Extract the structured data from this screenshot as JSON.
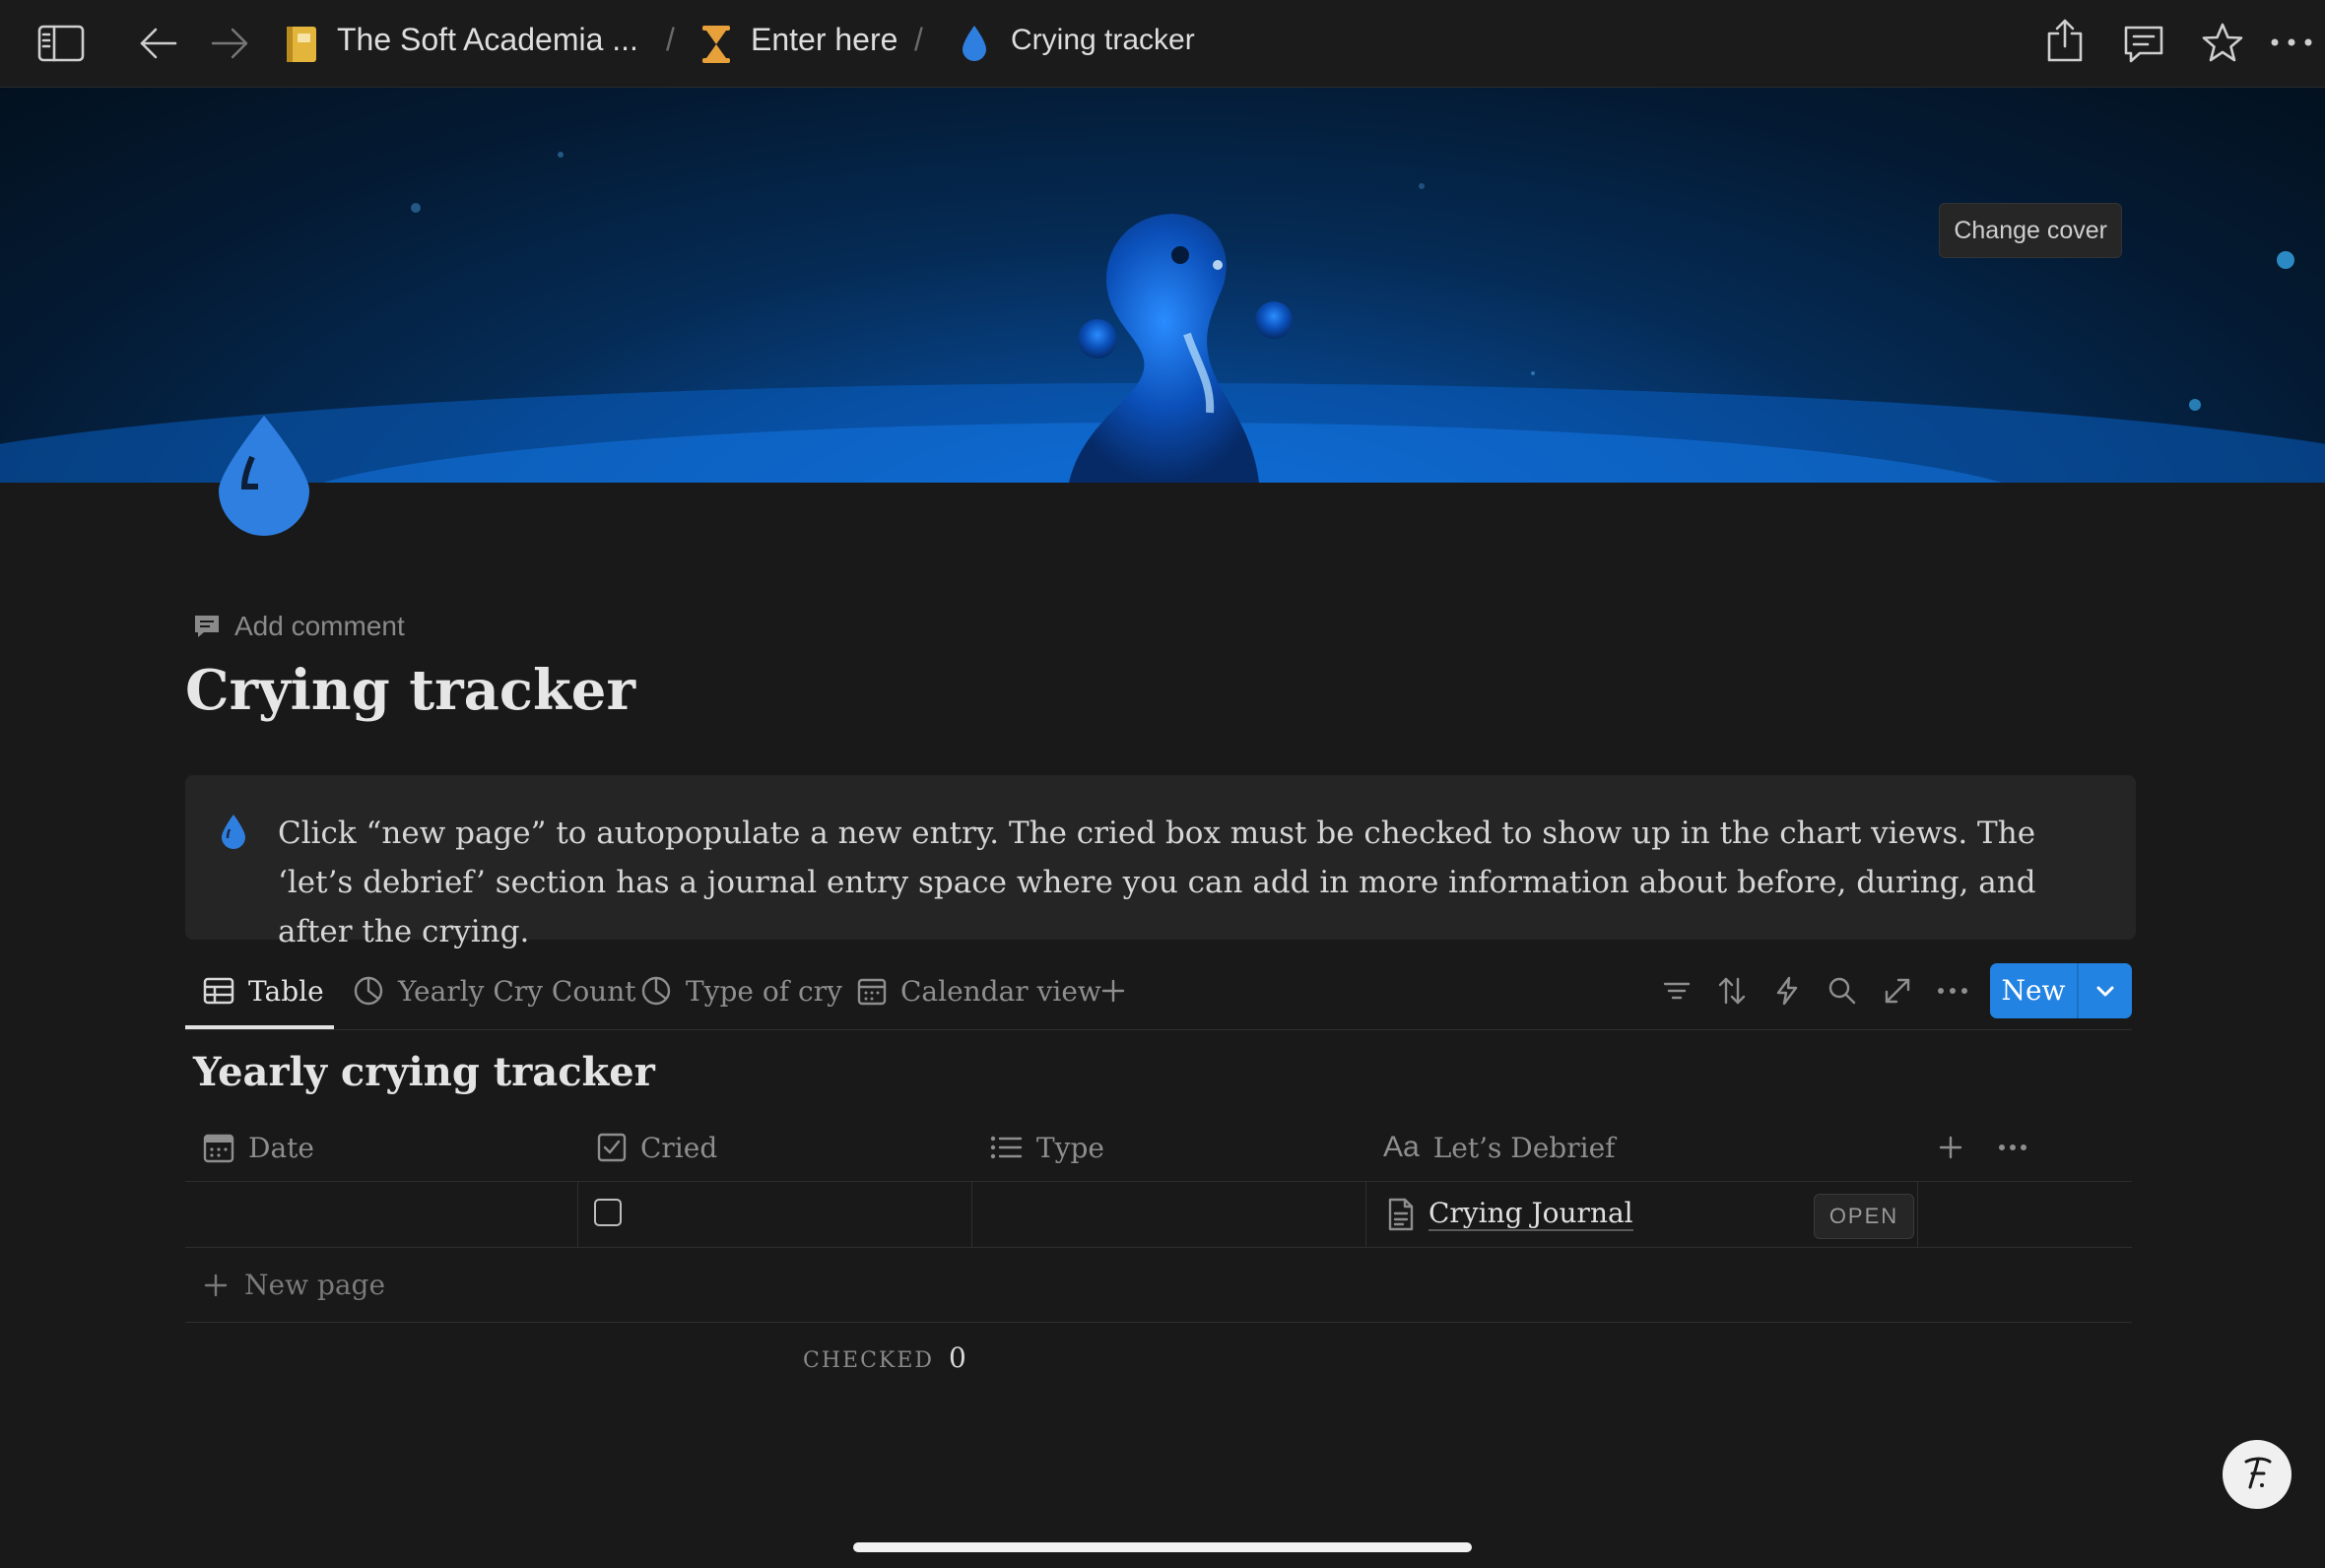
{
  "topbar": {
    "breadcrumbs": [
      {
        "label": "The Soft Academia ...",
        "icon": "notebook-icon"
      },
      {
        "label": "Enter here",
        "icon": "hourglass-icon"
      },
      {
        "label": "Crying tracker",
        "icon": "droplet-icon"
      }
    ],
    "separator": "/"
  },
  "cover": {
    "change_cover_label": "Change cover"
  },
  "page": {
    "add_comment_label": "Add comment",
    "title": "Crying tracker",
    "callout": "Click “new page” to autopopulate a new entry. The cried box must be checked to show up in the chart views. The ‘let’s debrief’ section has a journal entry space where you can add in more information about before, during, and after the crying."
  },
  "views": {
    "tabs": [
      {
        "label": "Table",
        "icon": "table-icon",
        "active": true
      },
      {
        "label": "Yearly Cry Count",
        "icon": "pie-chart-icon",
        "active": false
      },
      {
        "label": "Type of cry",
        "icon": "pie-chart-icon",
        "active": false
      },
      {
        "label": "Calendar view",
        "icon": "calendar-icon",
        "active": false
      }
    ],
    "new_button_label": "New"
  },
  "database": {
    "title": "Yearly crying tracker",
    "columns": [
      {
        "label": "Date",
        "icon": "calendar-icon"
      },
      {
        "label": "Cried",
        "icon": "checkbox-icon"
      },
      {
        "label": "Type",
        "icon": "list-icon"
      },
      {
        "label": "Let’s Debrief",
        "icon": "text-icon"
      }
    ],
    "text_prop_glyph": "Aa",
    "rows": [
      {
        "date": "",
        "cried": false,
        "type": "",
        "debrief": "Crying Journal"
      }
    ],
    "open_label": "OPEN",
    "new_page_label": "New page",
    "calc_label": "CHECKED",
    "calc_value": "0"
  },
  "colors": {
    "background": "#191919",
    "accent": "#2383e2",
    "droplet": "#2f7fe0"
  }
}
